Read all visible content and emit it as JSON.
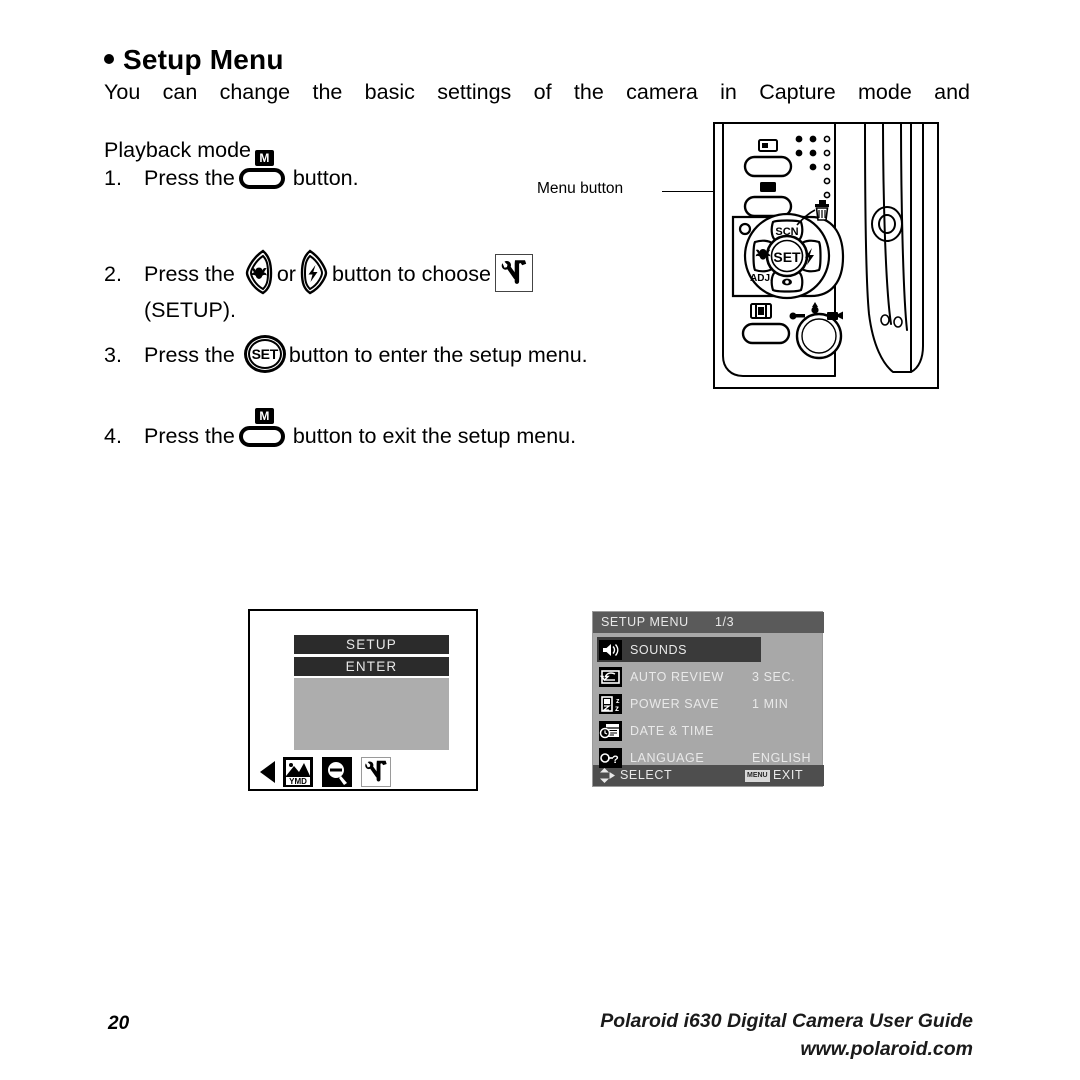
{
  "heading": {
    "bullet": "bullet-dot",
    "title": "Setup Menu"
  },
  "intro": {
    "line1": "You can change the basic settings of the camera in Capture mode and",
    "line2": "Playback mode"
  },
  "steps": [
    {
      "number": "1.",
      "before": "Press the",
      "after": "button.",
      "icon": "menu-m-button-icon"
    },
    {
      "number": "2.",
      "before": "Press the",
      "middle": "or",
      "after": "button to choose",
      "tail": "(SETUP).",
      "icon_left": "macro-left-arrow-button-icon",
      "icon_right": "flash-right-arrow-button-icon",
      "icon_end": "setup-wrench-hammer-icon"
    },
    {
      "number": "3.",
      "before": "Press the",
      "after": "button to enter the setup menu.",
      "icon": "set-button-icon"
    },
    {
      "number": "4.",
      "before": "Press the",
      "after": "button to exit the setup menu.",
      "icon": "menu-m-button-icon"
    }
  ],
  "glyphs": {
    "m_label": "M",
    "set_label": "SET"
  },
  "camera": {
    "callout_label": "Menu button",
    "pad_labels": {
      "set": "SET",
      "scn": "SCN",
      "adj": "ADJ."
    }
  },
  "lcd_left": {
    "bar_setup": "SETUP",
    "bar_enter": "ENTER",
    "icons": [
      {
        "name": "date-stamp-ymd-icon",
        "label": "YMD",
        "selected": false
      },
      {
        "name": "zoom-out-magnifier-icon",
        "label": "",
        "selected": false
      },
      {
        "name": "setup-wrench-hammer-icon",
        "label": "",
        "selected": true
      }
    ],
    "cursor": "left-triangle-cursor"
  },
  "lcd_right": {
    "title": "SETUP MENU",
    "page": "1/3",
    "rows": [
      {
        "icon": "speaker-sounds-icon",
        "label": "SOUNDS",
        "value": "",
        "active": true
      },
      {
        "icon": "auto-review-icon",
        "label": "AUTO REVIEW",
        "value": "3 SEC.",
        "active": false
      },
      {
        "icon": "power-save-icon",
        "label": "POWER SAVE",
        "value": "1 MIN",
        "active": false
      },
      {
        "icon": "date-time-icon",
        "label": "DATE & TIME",
        "value": "",
        "active": false
      },
      {
        "icon": "language-icon",
        "label": "LANGUAGE",
        "value": "ENGLISH",
        "active": false
      }
    ],
    "footer": {
      "select_label": "SELECT",
      "menu_badge": "MENU",
      "exit_label": "EXIT"
    }
  },
  "footer": {
    "page_number": "20",
    "guide_title": "Polaroid i630 Digital Camera User Guide",
    "website": "www.polaroid.com"
  },
  "colors": {
    "ink": "#000000",
    "lcd_bg": "#a8a8a8",
    "lcd_titlebar": "#5a5a5a",
    "lcd_footbar": "#4e4e4e",
    "lcd_highlight": "#3a3a3a",
    "lcd_text": "#e9e9e9",
    "bar_dark": "#2b2b2b",
    "pane_gray": "#adadad"
  }
}
